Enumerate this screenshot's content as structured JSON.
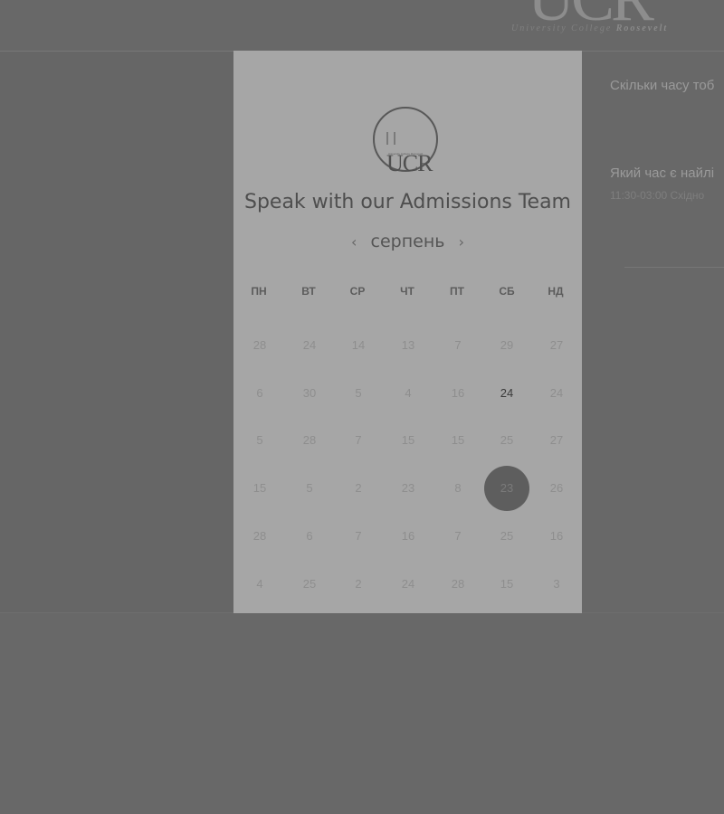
{
  "background": {
    "logo_letters": "UCR",
    "logo_tagline_prefix": "University College",
    "logo_tagline_name": "Roosevelt",
    "question1": "Скільки часу тоб",
    "question2": "Який час є найлі",
    "question2_sub": "11:30-03:00 Східно"
  },
  "modal": {
    "logo_letters": "UCR",
    "logo_sub": "University College Roosevelt",
    "title": "Speak with our Admissions Team",
    "month": "серпень",
    "prev_icon": "‹",
    "next_icon": "›",
    "weekdays": [
      "ПН",
      "ВТ",
      "СР",
      "ЧТ",
      "ПТ",
      "СБ",
      "НД"
    ],
    "weeks": [
      [
        "28",
        "24",
        "14",
        "13",
        "7",
        "29",
        "27"
      ],
      [
        "6",
        "30",
        "5",
        "4",
        "16",
        "24",
        "24"
      ],
      [
        "5",
        "28",
        "7",
        "15",
        "15",
        "25",
        "27"
      ],
      [
        "15",
        "5",
        "2",
        "23",
        "8",
        "23",
        "26"
      ],
      [
        "28",
        "6",
        "7",
        "16",
        "7",
        "25",
        "16"
      ],
      [
        "4",
        "25",
        "2",
        "24",
        "28",
        "15",
        "3"
      ]
    ],
    "available": [
      [
        1,
        5
      ]
    ],
    "selected": [
      3,
      5
    ]
  },
  "colors": {
    "overlay": "#686868",
    "modal_bg": "#a6a6a6",
    "selected_day": "#5e5e5e"
  }
}
